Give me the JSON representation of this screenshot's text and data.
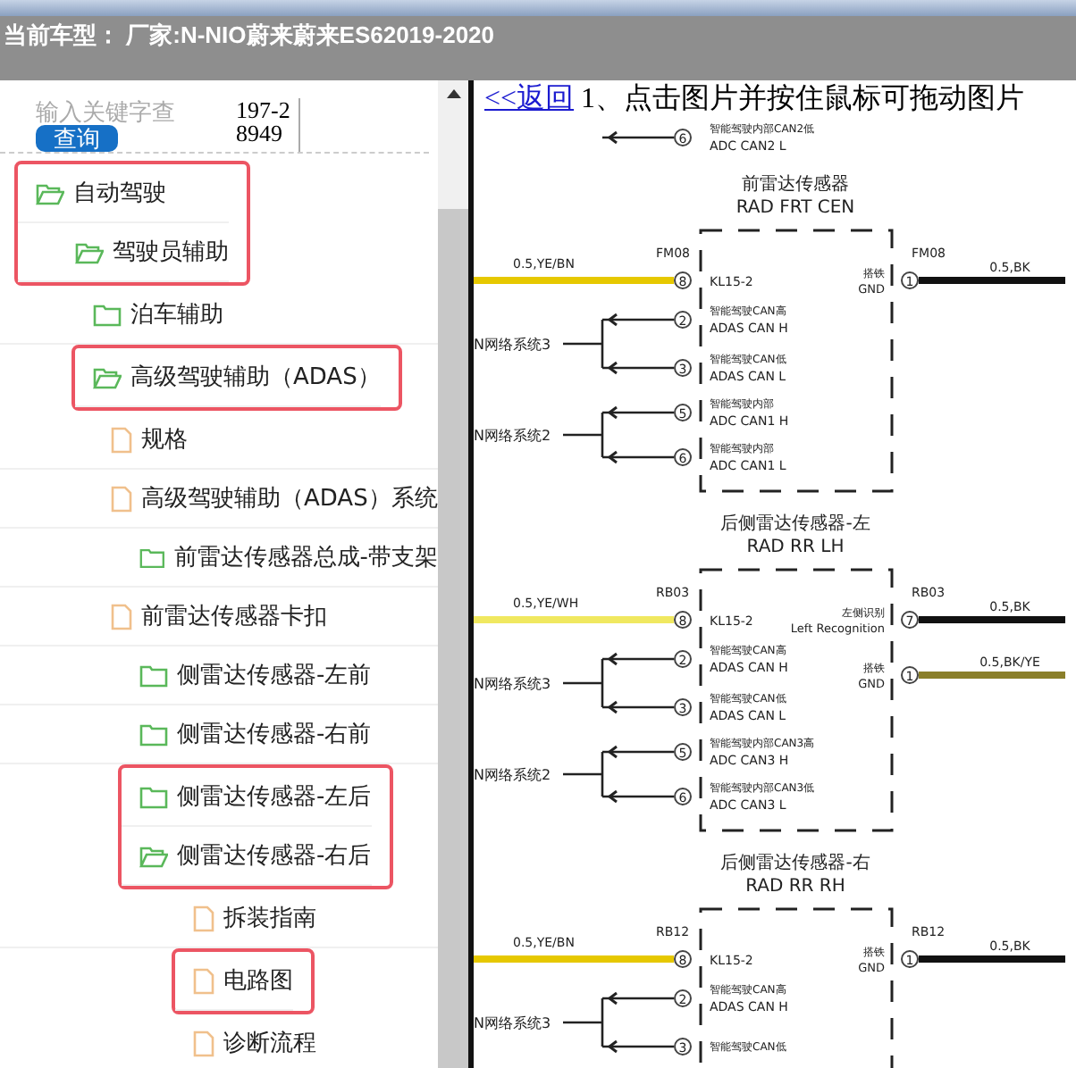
{
  "header": {
    "title": "当前车型： 厂家:N-NIO蔚来蔚来ES62019-2020"
  },
  "search": {
    "placeholder": "输入关键字查",
    "button": "查询",
    "count": "197-28949"
  },
  "tree": [
    {
      "label": "自动驾驶",
      "kind": "folder",
      "expanded": true,
      "highlighted": true,
      "children": [
        {
          "label": "驾驶员辅助",
          "kind": "folder",
          "expanded": true,
          "highlighted": true,
          "children": [
            {
              "label": "泊车辅助",
              "kind": "folder",
              "expanded": false,
              "highlighted": false
            },
            {
              "label": "高级驾驶辅助（ADAS）",
              "kind": "folder",
              "expanded": true,
              "highlighted": true,
              "children": [
                {
                  "label": "规格",
                  "kind": "doc",
                  "highlighted": false
                },
                {
                  "label": "高级驾驶辅助（ADAS）系统",
                  "kind": "doc",
                  "highlighted": false,
                  "children": [
                    {
                      "label": "前雷达传感器总成-带支架",
                      "kind": "folder",
                      "expanded": false,
                      "highlighted": false
                    }
                  ]
                },
                {
                  "label": "前雷达传感器卡扣",
                  "kind": "doc",
                  "highlighted": false,
                  "children": [
                    {
                      "label": "侧雷达传感器-左前",
                      "kind": "folder",
                      "expanded": false,
                      "highlighted": false
                    },
                    {
                      "label": "侧雷达传感器-右前",
                      "kind": "folder",
                      "expanded": false,
                      "highlighted": false
                    },
                    {
                      "label": "侧雷达传感器-左后",
                      "kind": "folder",
                      "expanded": false,
                      "highlighted": true
                    },
                    {
                      "label": "侧雷达传感器-右后",
                      "kind": "folder",
                      "expanded": true,
                      "highlighted": true,
                      "children": [
                        {
                          "label": "拆装指南",
                          "kind": "doc",
                          "highlighted": false
                        },
                        {
                          "label": "电路图",
                          "kind": "doc",
                          "highlighted": true
                        },
                        {
                          "label": "诊断流程",
                          "kind": "doc",
                          "highlighted": false
                        }
                      ]
                    }
                  ]
                }
              ]
            }
          ]
        }
      ]
    }
  ],
  "content": {
    "back_link": "<<返回",
    "instruction": "1、点击图片并按住鼠标可拖动图片"
  },
  "diagram": {
    "sections": [
      {
        "pins": [
          {
            "num": "6",
            "cn": "智能驾驶内部CAN2低",
            "en": "ADC CAN2 L"
          }
        ]
      },
      {
        "title_cn": "前雷达传感器",
        "title_en": "RAD FRT CEN",
        "code": "FM08",
        "left_wire": {
          "label": "0.5,YE/BN",
          "color": "#e6c800"
        },
        "pins": [
          {
            "num": "8",
            "en": "KL15-2"
          },
          {
            "num": "2",
            "cn": "智能驾驶CAN高",
            "en": "ADAS CAN H"
          },
          {
            "num": "3",
            "cn": "智能驾驶CAN低",
            "en": "ADAS CAN L"
          },
          {
            "num": "5",
            "cn": "智能驾驶内部",
            "en": "ADC CAN1 H"
          },
          {
            "num": "6",
            "cn": "智能驾驶内部",
            "en": "ADC CAN1 L"
          }
        ],
        "right_pins": [
          {
            "num": "1",
            "code": "FM08",
            "cn": "搭铁",
            "en": "GND",
            "wire_label": "0.5,BK",
            "color": "#111111"
          }
        ],
        "networks": [
          "N网络系统3",
          "N网络系统2"
        ]
      },
      {
        "title_cn": "后侧雷达传感器-左",
        "title_en": "RAD RR LH",
        "code": "RB03",
        "left_wire": {
          "label": "0.5,YE/WH",
          "color": "#f0e860"
        },
        "pins": [
          {
            "num": "8",
            "en": "KL15-2"
          },
          {
            "num": "2",
            "cn": "智能驾驶CAN高",
            "en": "ADAS CAN H"
          },
          {
            "num": "3",
            "cn": "智能驾驶CAN低",
            "en": "ADAS CAN L"
          },
          {
            "num": "5",
            "cn": "智能驾驶内部CAN3高",
            "en": "ADC CAN3 H"
          },
          {
            "num": "6",
            "cn": "智能驾驶内部CAN3低",
            "en": "ADC CAN3 L"
          }
        ],
        "right_pins": [
          {
            "num": "7",
            "code": "RB03",
            "cn": "左侧识别",
            "en": "Left Recognition",
            "wire_label": "0.5,BK",
            "color": "#111111"
          },
          {
            "num": "1",
            "cn": "搭铁",
            "en": "GND",
            "wire_label": "0.5,BK/YE",
            "color": "#8a7f2a"
          }
        ],
        "networks": [
          "N网络系统3",
          "N网络系统2"
        ]
      },
      {
        "title_cn": "后侧雷达传感器-右",
        "title_en": "RAD RR RH",
        "code": "RB12",
        "left_wire": {
          "label": "0.5,YE/BN",
          "color": "#e6c800"
        },
        "pins": [
          {
            "num": "8",
            "en": "KL15-2"
          },
          {
            "num": "2",
            "cn": "智能驾驶CAN高",
            "en": "ADAS CAN H"
          },
          {
            "num": "3",
            "cn": "智能驾驶CAN低"
          }
        ],
        "right_pins": [
          {
            "num": "1",
            "code": "RB12",
            "cn": "搭铁",
            "en": "GND",
            "wire_label": "0.5,BK",
            "color": "#111111"
          }
        ],
        "networks": [
          "N网络系统3"
        ]
      }
    ]
  }
}
